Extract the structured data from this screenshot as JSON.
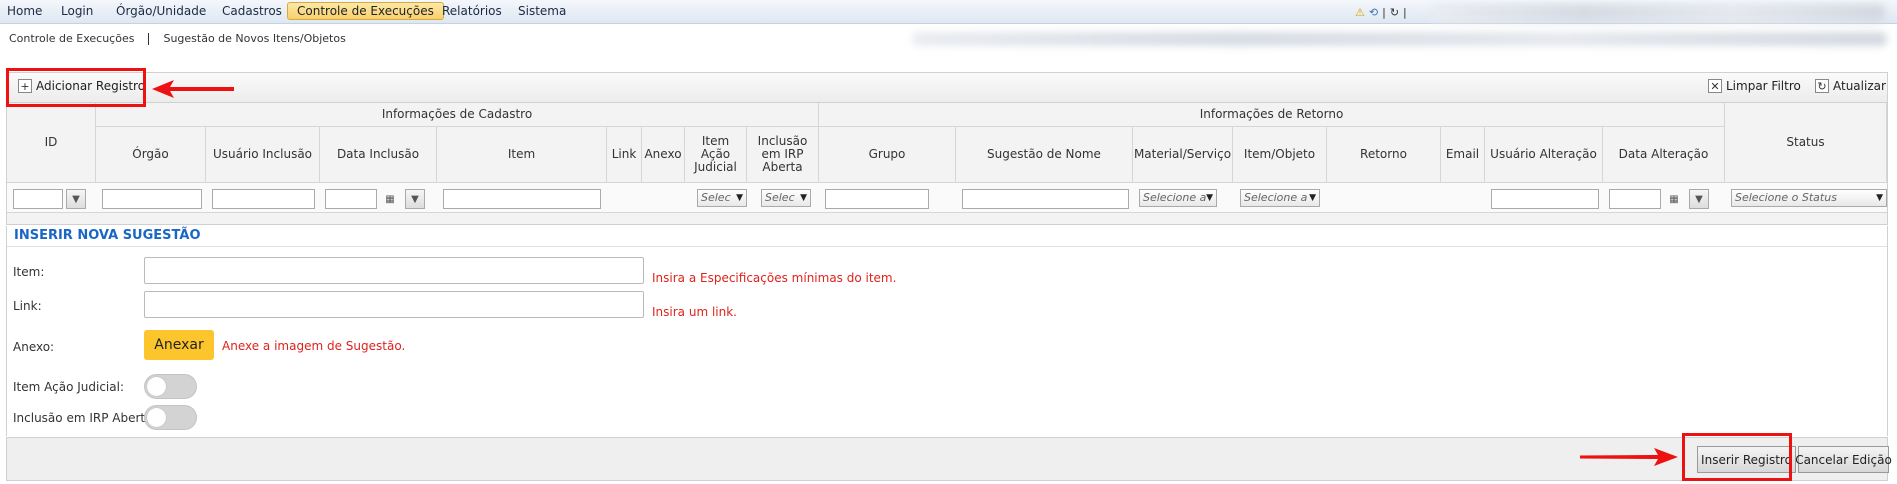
{
  "menu": {
    "items": [
      "Home",
      "Login",
      "Órgão/Unidade",
      "Cadastros",
      "Controle de Execuções",
      "Relatórios",
      "Sistema"
    ],
    "active_index": 4
  },
  "breadcrumb": [
    "Controle de Execuções",
    "Sugestão de Novos Itens/Objetos"
  ],
  "toolbar": {
    "add": "Adicionar Registro",
    "clear_filter": "Limpar Filtro",
    "refresh": "Atualizar"
  },
  "grid": {
    "group_cadastro": "Informações de Cadastro",
    "group_retorno": "Informações de Retorno",
    "col_id": "ID",
    "col_orgao": "Órgão",
    "col_usuario_inclusao": "Usuário Inclusão",
    "col_data_inclusao": "Data Inclusão",
    "col_item": "Item",
    "col_link": "Link",
    "col_anexo": "Anexo",
    "col_item_acao_judicial": "Item Ação Judicial",
    "col_inclusao_irp": "Inclusão em IRP Aberta",
    "col_grupo": "Grupo",
    "col_sugestao_nome": "Sugestão de Nome",
    "col_material_servico": "Material/Serviço",
    "col_item_objeto": "Item/Objeto",
    "col_retorno": "Retorno",
    "col_email": "Email",
    "col_usuario_alteracao": "Usuário Alteração",
    "col_data_alteracao": "Data Alteração",
    "col_status": "Status",
    "filter_sel_short": "Selec",
    "filter_sel_mid": "Selecione a",
    "filter_sel_status": "Selecione o Status"
  },
  "form": {
    "title": "INSERIR NOVA SUGESTÃO",
    "item_label": "Item:",
    "item_hint": "Insira a Especificações mínimas do item.",
    "link_label": "Link:",
    "link_hint": "Insira um link.",
    "anexo_label": "Anexo:",
    "anexar_button": "Anexar",
    "anexo_hint": "Anexe a imagem de Sugestão.",
    "acao_judicial_label": "Item Ação Judicial:",
    "irp_label": "Inclusão em IRP Aberta:",
    "acao_judicial_on": false,
    "irp_on": false
  },
  "footer": {
    "insert": "Inserir Registro",
    "cancel": "Cancelar Edição"
  },
  "colors": {
    "accent_title": "#1a66c7",
    "hint_red": "#e0221d",
    "anexar_yellow": "#fcc52c",
    "annotation_red": "#ee1111"
  }
}
